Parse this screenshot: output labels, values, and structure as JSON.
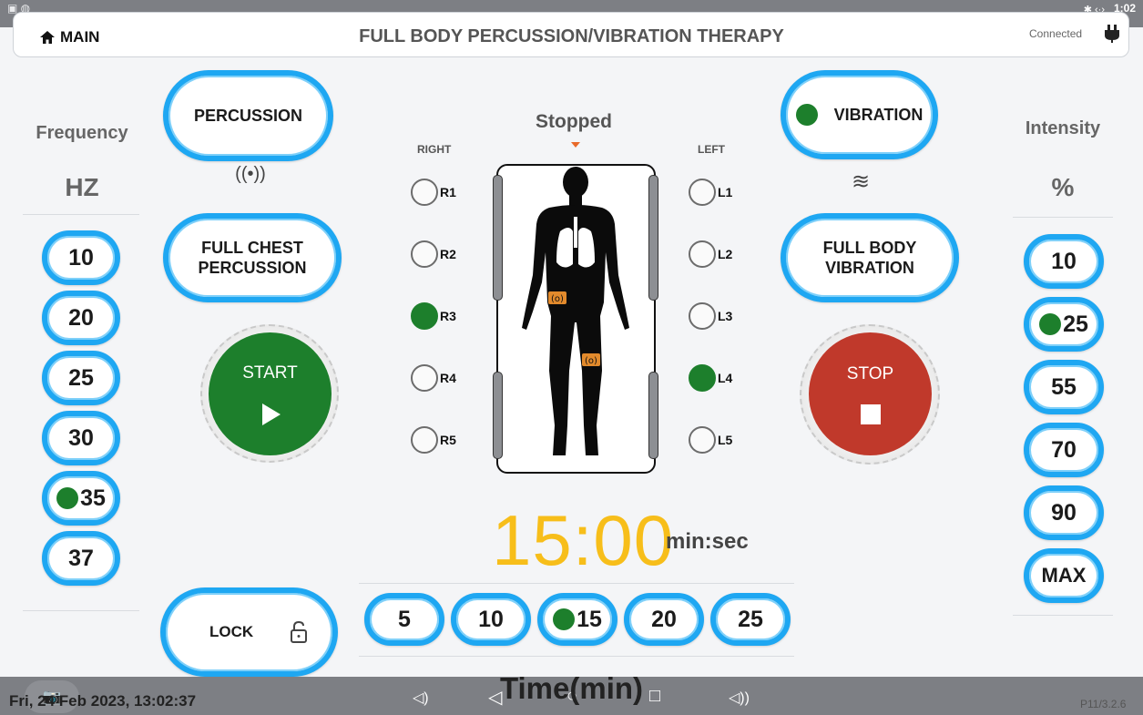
{
  "header": {
    "home_label": "MAIN",
    "title": "FULL BODY PERCUSSION/VIBRATION THERAPY",
    "connection": "Connected"
  },
  "statusbar": {
    "time": "1:02"
  },
  "frequency": {
    "title": "Frequency",
    "unit": "HZ",
    "options": [
      "10",
      "20",
      "25",
      "30",
      "35",
      "37"
    ],
    "selected": "35"
  },
  "intensity": {
    "title": "Intensity",
    "unit": "%",
    "options": [
      "10",
      "25",
      "55",
      "70",
      "90",
      "MAX"
    ],
    "selected": "25"
  },
  "modes": {
    "percussion": "PERCUSSION",
    "vibration": "VIBRATION",
    "vibration_selected": true,
    "full_chest": [
      "FULL CHEST",
      "PERCUSSION"
    ],
    "full_body": [
      "FULL BODY",
      "VIBRATION"
    ]
  },
  "controls": {
    "start": "START",
    "stop": "STOP",
    "lock": "LOCK"
  },
  "body": {
    "status": "Stopped",
    "right_label": "RIGHT",
    "left_label": "LEFT",
    "right": [
      {
        "label": "R1",
        "on": false
      },
      {
        "label": "R2",
        "on": false
      },
      {
        "label": "R3",
        "on": true
      },
      {
        "label": "R4",
        "on": false
      },
      {
        "label": "R5",
        "on": false
      }
    ],
    "left": [
      {
        "label": "L1",
        "on": false
      },
      {
        "label": "L2",
        "on": false
      },
      {
        "label": "L3",
        "on": false
      },
      {
        "label": "L4",
        "on": true
      },
      {
        "label": "L5",
        "on": false
      }
    ]
  },
  "timer": {
    "value": "15:00",
    "unit": "min:sec"
  },
  "time": {
    "title": "Time(min)",
    "options": [
      "5",
      "10",
      "15",
      "20",
      "25"
    ],
    "selected": "15"
  },
  "footer": {
    "datetime": "Fri, 24 Feb 2023, 13:02:37",
    "version": "P11/3.2.6"
  },
  "colors": {
    "accent_blue": "#1ea7f2",
    "start_green": "#1d7f2c",
    "stop_red": "#c0392b",
    "timer_yellow": "#f7be1a"
  }
}
